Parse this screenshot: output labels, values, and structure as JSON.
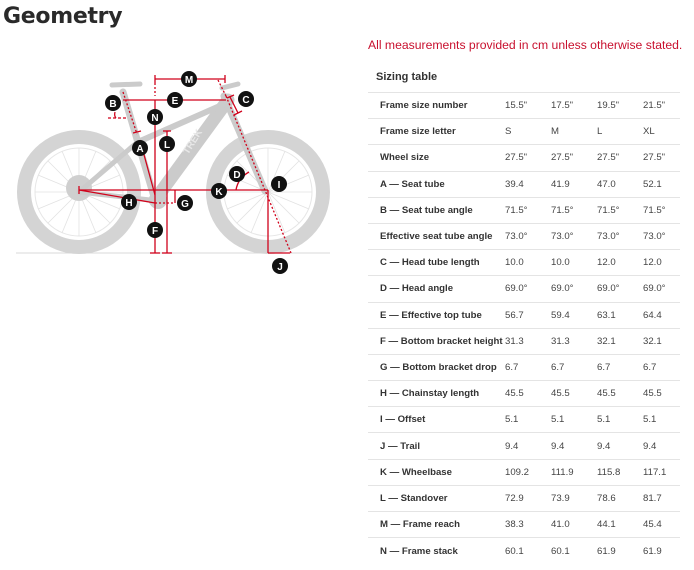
{
  "page": {
    "title": "Geometry",
    "notice": "All measurements provided in cm unless otherwise stated."
  },
  "diagram": {
    "brand_on_frame": "TREK",
    "markers": [
      "A",
      "B",
      "C",
      "D",
      "E",
      "F",
      "G",
      "H",
      "I",
      "J",
      "K",
      "L",
      "M",
      "N"
    ],
    "colors": {
      "marker_fill": "#111111",
      "marker_text": "#ffffff",
      "lines": "#d0021b",
      "bike": "#cfcfcf"
    }
  },
  "sizing_table": {
    "title": "Sizing table",
    "rows": [
      {
        "label": "Frame size number",
        "values": [
          "15.5\"",
          "17.5\"",
          "19.5\"",
          "21.5\""
        ]
      },
      {
        "label": "Frame size letter",
        "values": [
          "S",
          "M",
          "L",
          "XL"
        ]
      },
      {
        "label": "Wheel size",
        "values": [
          "27.5\"",
          "27.5\"",
          "27.5\"",
          "27.5\""
        ]
      },
      {
        "label": "A — Seat tube",
        "values": [
          "39.4",
          "41.9",
          "47.0",
          "52.1"
        ]
      },
      {
        "label": "B — Seat tube angle",
        "values": [
          "71.5°",
          "71.5°",
          "71.5°",
          "71.5°"
        ]
      },
      {
        "label": "Effective seat tube angle",
        "values": [
          "73.0°",
          "73.0°",
          "73.0°",
          "73.0°"
        ]
      },
      {
        "label": "C — Head tube length",
        "values": [
          "10.0",
          "10.0",
          "12.0",
          "12.0"
        ]
      },
      {
        "label": "D — Head angle",
        "values": [
          "69.0°",
          "69.0°",
          "69.0°",
          "69.0°"
        ]
      },
      {
        "label": "E — Effective top tube",
        "values": [
          "56.7",
          "59.4",
          "63.1",
          "64.4"
        ]
      },
      {
        "label": "F — Bottom bracket height",
        "values": [
          "31.3",
          "31.3",
          "32.1",
          "32.1"
        ]
      },
      {
        "label": "G — Bottom bracket drop",
        "values": [
          "6.7",
          "6.7",
          "6.7",
          "6.7"
        ]
      },
      {
        "label": "H — Chainstay length",
        "values": [
          "45.5",
          "45.5",
          "45.5",
          "45.5"
        ]
      },
      {
        "label": "I — Offset",
        "values": [
          "5.1",
          "5.1",
          "5.1",
          "5.1"
        ]
      },
      {
        "label": "J — Trail",
        "values": [
          "9.4",
          "9.4",
          "9.4",
          "9.4"
        ]
      },
      {
        "label": "K — Wheelbase",
        "values": [
          "109.2",
          "111.9",
          "115.8",
          "117.1"
        ]
      },
      {
        "label": "L — Standover",
        "values": [
          "72.9",
          "73.9",
          "78.6",
          "81.7"
        ]
      },
      {
        "label": "M — Frame reach",
        "values": [
          "38.3",
          "41.0",
          "44.1",
          "45.4"
        ]
      },
      {
        "label": "N — Frame stack",
        "values": [
          "60.1",
          "60.1",
          "61.9",
          "61.9"
        ]
      }
    ]
  }
}
